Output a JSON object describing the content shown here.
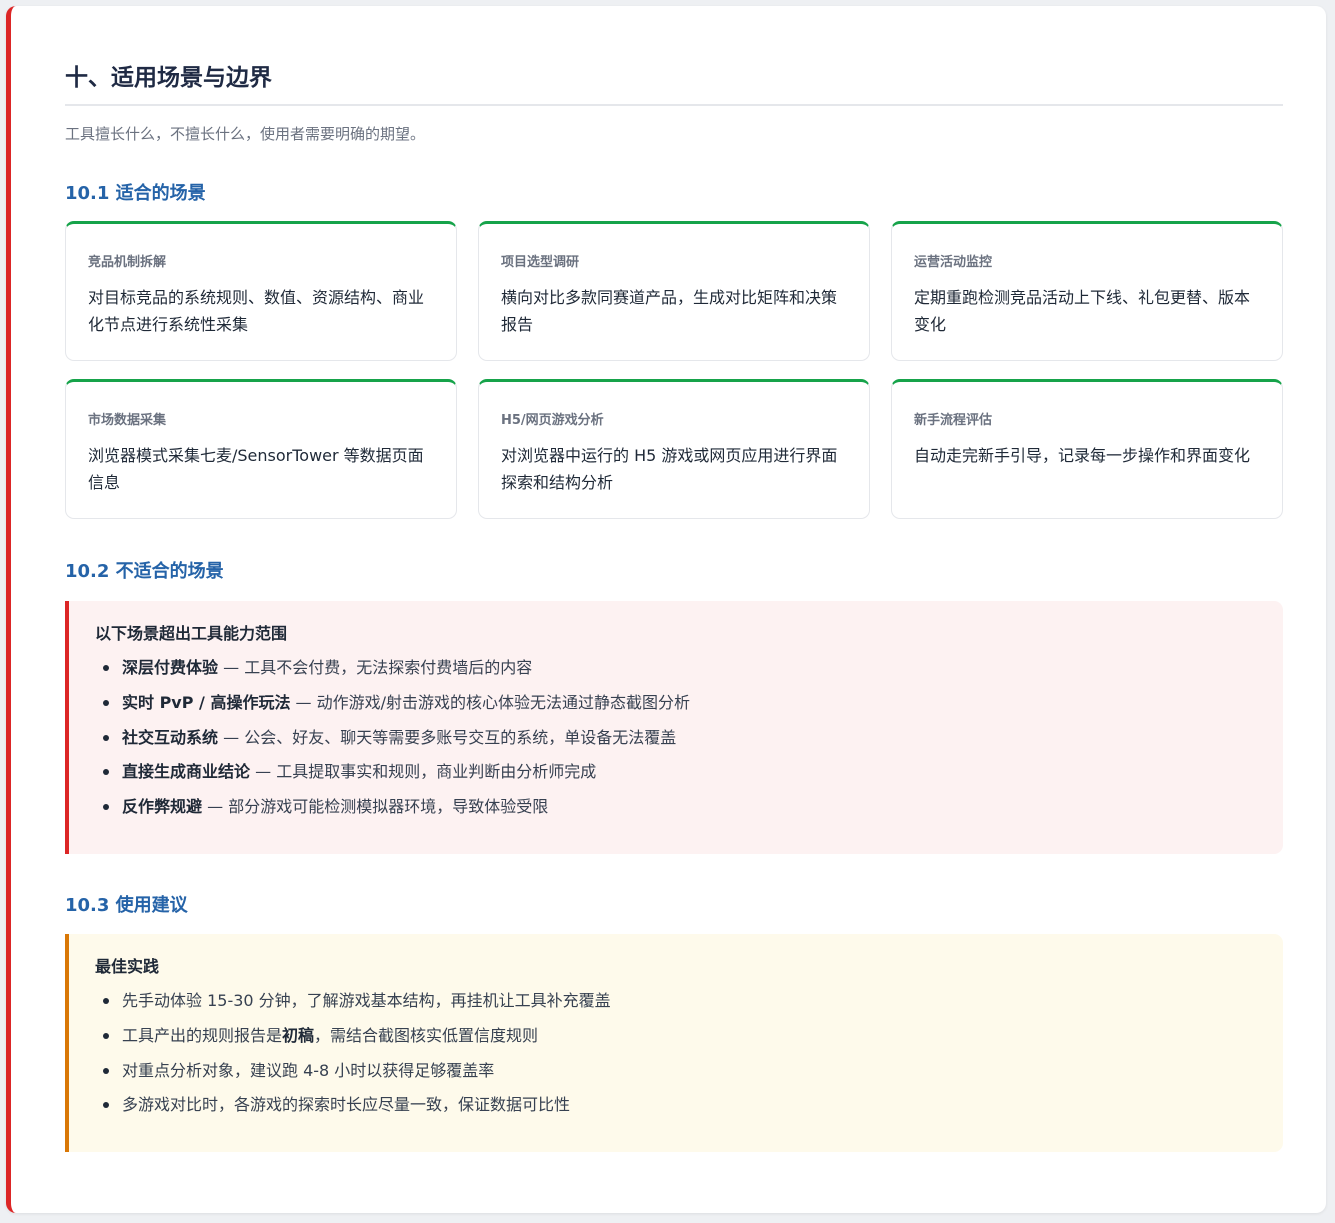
{
  "title": "十、适用场景与边界",
  "subtitle": "工具擅长什么，不擅长什么，使用者需要明确的期望。",
  "section1": {
    "heading": "10.1 适合的场景",
    "cards": [
      {
        "label": "竞品机制拆解",
        "text": "对目标竞品的系统规则、数值、资源结构、商业化节点进行系统性采集"
      },
      {
        "label": "项目选型调研",
        "text": "横向对比多款同赛道产品，生成对比矩阵和决策报告"
      },
      {
        "label": "运营活动监控",
        "text": "定期重跑检测竞品活动上下线、礼包更替、版本变化"
      },
      {
        "label": "市场数据采集",
        "text": "浏览器模式采集七麦/SensorTower 等数据页面信息"
      },
      {
        "label": "H5/网页游戏分析",
        "text": "对浏览器中运行的 H5 游戏或网页应用进行界面探索和结构分析"
      },
      {
        "label": "新手流程评估",
        "text": "自动走完新手引导，记录每一步操作和界面变化"
      }
    ],
    "accent_color": "#16a34a"
  },
  "section2": {
    "heading": "10.2 不适合的场景",
    "callout_title": "以下场景超出工具能力范围",
    "items": [
      {
        "bold": "深层付费体验",
        "rest": " — 工具不会付费，无法探索付费墙后的内容"
      },
      {
        "bold": "实时 PvP / 高操作玩法",
        "rest": " — 动作游戏/射击游戏的核心体验无法通过静态截图分析"
      },
      {
        "bold": "社交互动系统",
        "rest": " — 公会、好友、聊天等需要多账号交互的系统，单设备无法覆盖"
      },
      {
        "bold": "直接生成商业结论",
        "rest": " — 工具提取事实和规则，商业判断由分析师完成"
      },
      {
        "bold": "反作弊规避",
        "rest": " — 部分游戏可能检测模拟器环境，导致体验受限"
      }
    ],
    "accent_color": "#dc2626"
  },
  "section3": {
    "heading": "10.3 使用建议",
    "callout_title": "最佳实践",
    "items": [
      {
        "pre": "先手动体验 15-30 分钟，了解游戏基本结构，再挂机让工具补充覆盖",
        "bold": "",
        "post": ""
      },
      {
        "pre": "工具产出的规则报告是",
        "bold": "初稿",
        "post": "，需结合截图核实低置信度规则"
      },
      {
        "pre": "对重点分析对象，建议跑 4-8 小时以获得足够覆盖率",
        "bold": "",
        "post": ""
      },
      {
        "pre": "多游戏对比时，各游戏的探索时长应尽量一致，保证数据可比性",
        "bold": "",
        "post": ""
      }
    ],
    "accent_color": "#d97706"
  }
}
